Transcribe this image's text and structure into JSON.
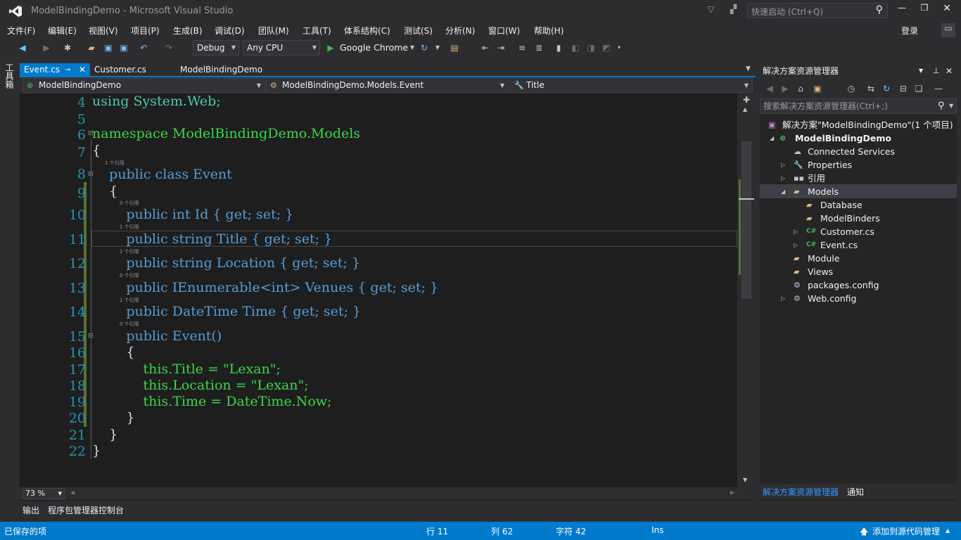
{
  "window": {
    "title": "ModelBindingDemo - Microsoft Visual Studio",
    "quick_launch_placeholder": "快速启动 (Ctrl+Q)",
    "login": "登录"
  },
  "menu": [
    "文件(F)",
    "编辑(E)",
    "视图(V)",
    "项目(P)",
    "生成(B)",
    "调试(D)",
    "团队(M)",
    "工具(T)",
    "体系结构(C)",
    "测试(S)",
    "分析(N)",
    "窗口(W)",
    "帮助(H)"
  ],
  "toolbar": {
    "config": "Debug",
    "platform": "Any CPU",
    "run_target": "Google Chrome"
  },
  "left_tab": "工具箱",
  "doc_tabs": [
    {
      "label": "Event.cs",
      "active": true
    },
    {
      "label": "Customer.cs",
      "active": false
    },
    {
      "label": "ModelBindingDemo",
      "active": false
    }
  ],
  "nav": {
    "project": "ModelBindingDemo",
    "type": "ModelBindingDemo.Models.Event",
    "member": "Title"
  },
  "code": {
    "lines": [
      {
        "n": "4",
        "ref": "",
        "text": "using System.Web;"
      },
      {
        "n": "5",
        "ref": "",
        "text": ""
      },
      {
        "n": "6",
        "ref": "",
        "text": "namespace ModelBindingDemo.Models"
      },
      {
        "n": "7",
        "ref": "",
        "text": "{"
      },
      {
        "n": "8",
        "ref": "1 个引用",
        "text": "    public class Event"
      },
      {
        "n": "9",
        "ref": "",
        "text": "    {"
      },
      {
        "n": "10",
        "ref": "0 个引用",
        "text": "        public int Id { get; set; }"
      },
      {
        "n": "11",
        "ref": "1 个引用",
        "text": "        public string Title { get; set; }"
      },
      {
        "n": "12",
        "ref": "1 个引用",
        "text": "        public string Location { get; set; }"
      },
      {
        "n": "13",
        "ref": "0 个引用",
        "text": "        public IEnumerable<int> Venues { get; set; }"
      },
      {
        "n": "14",
        "ref": "1 个引用",
        "text": "        public DateTime Time { get; set; }"
      },
      {
        "n": "15",
        "ref": "0 个引用",
        "text": "        public Event()"
      },
      {
        "n": "16",
        "ref": "",
        "text": "        {"
      },
      {
        "n": "17",
        "ref": "",
        "text": "            this.Title = \"Lexan\";"
      },
      {
        "n": "18",
        "ref": "",
        "text": "            this.Location = \"Lexan\";"
      },
      {
        "n": "19",
        "ref": "",
        "text": "            this.Time = DateTime.Now;"
      },
      {
        "n": "20",
        "ref": "",
        "text": "        }"
      },
      {
        "n": "21",
        "ref": "",
        "text": "    }"
      },
      {
        "n": "22",
        "ref": "",
        "text": "}"
      }
    ]
  },
  "zoom": "73 %",
  "solution_explorer": {
    "title": "解决方案资源管理器",
    "search_placeholder": "搜索解决方案资源管理器(Ctrl+;)",
    "items": [
      {
        "label": "解决方案\"ModelBindingDemo\"(1 个项目)",
        "icon": "solution-icon"
      },
      {
        "label": "ModelBindingDemo",
        "icon": "project-icon"
      },
      {
        "label": "Connected Services",
        "icon": "cloud-icon"
      },
      {
        "label": "Properties",
        "icon": "wrench-icon"
      },
      {
        "label": "引用",
        "icon": "references-icon"
      },
      {
        "label": "Models",
        "icon": "folder-open-icon"
      },
      {
        "label": "Database",
        "icon": "folder-icon"
      },
      {
        "label": "ModelBinders",
        "icon": "folder-icon"
      },
      {
        "label": "Customer.cs",
        "icon": "csharp-file-icon"
      },
      {
        "label": "Event.cs",
        "icon": "csharp-file-icon"
      },
      {
        "label": "Module",
        "icon": "folder-icon"
      },
      {
        "label": "Views",
        "icon": "folder-icon"
      },
      {
        "label": "packages.config",
        "icon": "config-file-icon"
      },
      {
        "label": "Web.config",
        "icon": "config-file-icon"
      }
    ],
    "tabs": [
      "解决方案资源管理器",
      "通知"
    ]
  },
  "bottom_tabs": [
    "输出",
    "程序包管理器控制台"
  ],
  "status": {
    "message": "已保存的项",
    "line": "行 11",
    "col": "列 62",
    "char": "字符 42",
    "mode": "Ins",
    "source_control": "添加到源代码管理"
  },
  "colors": {
    "accent": "#007acc",
    "keyword": "#569cd6",
    "identifier": "#3cd64a",
    "string": "#d69d85"
  }
}
